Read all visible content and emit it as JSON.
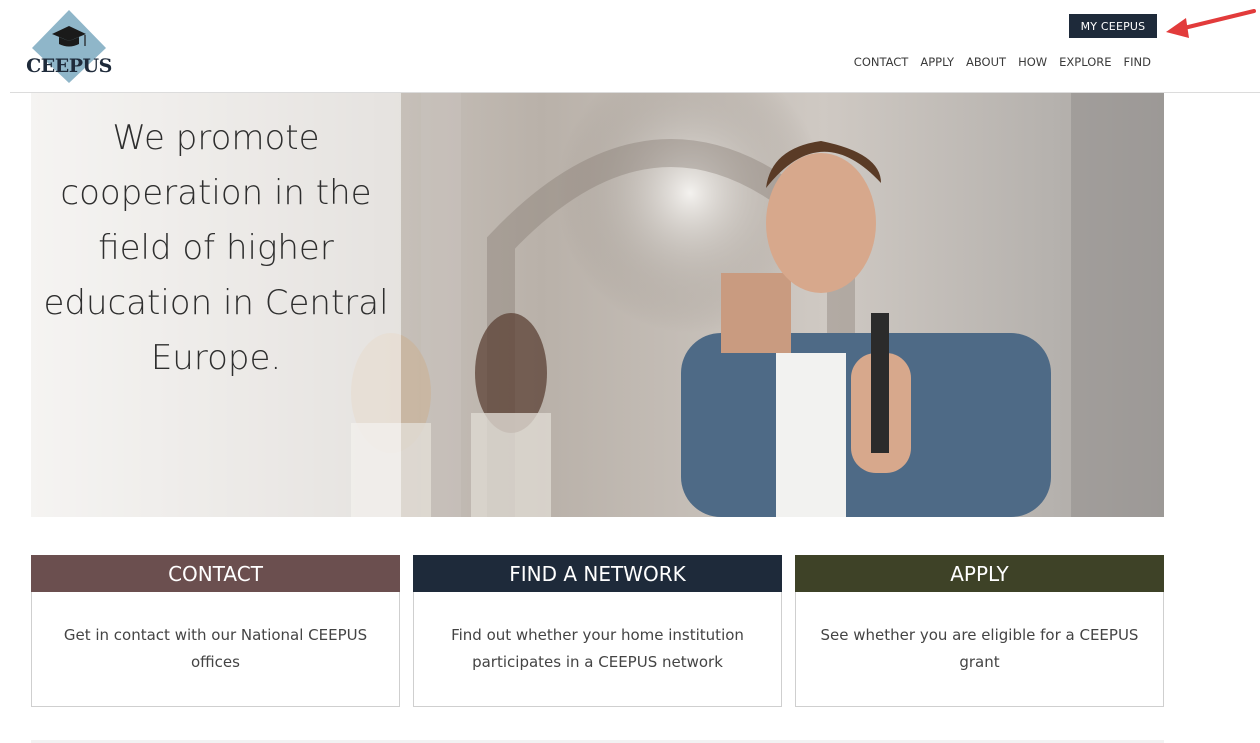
{
  "header": {
    "logo_text": "CEEPUS",
    "my_ceepus_label": "MY CEEPUS",
    "nav": [
      "CONTACT",
      "APPLY",
      "ABOUT",
      "HOW",
      "EXPLORE",
      "FIND"
    ]
  },
  "hero": {
    "headline_lines": [
      "We promote",
      "cooperation in the",
      "field of higher",
      "education in Central",
      "Europe."
    ]
  },
  "cards": [
    {
      "title": "CONTACT",
      "body": "Get in contact with our National CEEPUS offices",
      "color": "#6b4f4f"
    },
    {
      "title": "FIND A NETWORK",
      "body": "Find out whether your home institution participates in a CEEPUS network",
      "color": "#1e2a3a"
    },
    {
      "title": "APPLY",
      "body": "See whether you are eligible for a CEEPUS grant",
      "color": "#3e4227"
    }
  ],
  "colors": {
    "annotation_arrow": "#e23b3b",
    "logo_diamond": "#8fb6c9"
  }
}
